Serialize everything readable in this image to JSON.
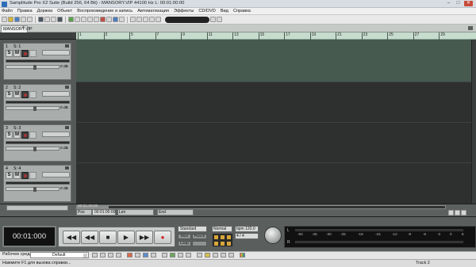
{
  "window": {
    "title": "Samplitude Pro X2 Suite (Build 256, 64 Bit)   -   MANSORY.VIP   44100 Hz L: 00:01:00:00",
    "minimize": "–",
    "maximize": "□",
    "close": "✕"
  },
  "menu": [
    "Файл",
    "Правка",
    "Доржка",
    "Объект",
    "Воспроизведение и запись",
    "Автоматизация",
    "Эффекты",
    "CD/DVD",
    "Вид",
    "Справка"
  ],
  "tab": {
    "label": "MANSORY.VIP",
    "close": "x"
  },
  "ruler": {
    "ticks": [
      "1",
      "3",
      "5",
      "7",
      "9",
      "11",
      "13",
      "15",
      "17",
      "19",
      "21",
      "23",
      "25",
      "27",
      "29"
    ]
  },
  "tracks": [
    {
      "number": "1",
      "name": "S: 1",
      "solo": "S",
      "mute": "M",
      "volume_db": "0 dB"
    },
    {
      "number": "2",
      "name": "S: 2",
      "solo": "S",
      "mute": "M",
      "volume_db": "0 dB"
    },
    {
      "number": "3",
      "name": "S: 3",
      "solo": "S",
      "mute": "M",
      "volume_db": "0 dB"
    },
    {
      "number": "4",
      "name": "S: 4",
      "solo": "S",
      "mute": "M",
      "volume_db": "0 dB"
    }
  ],
  "position": {
    "time_small": "00:01:00:00",
    "pos_label": "Pos",
    "pos_value": "00:01:00:00",
    "len_label": "Len",
    "len_value": "",
    "end_label": "End",
    "end_value": ""
  },
  "transport": {
    "time": "00:01:000",
    "mode": "Standard",
    "mode_buttons": [
      "Mon",
      "Punch",
      "Loop"
    ],
    "sync_mode": "Normal",
    "bpm": "bpm 120.0",
    "signature": "4 / 4",
    "symbols": {
      "rewind": "◀◀",
      "ffwd": "▶▶",
      "stop": "■",
      "play": "▶",
      "fwd": "▶▶",
      "rec": "●"
    }
  },
  "meter": {
    "left": "L",
    "right": "R",
    "scale": [
      "-60",
      "-45",
      "-30",
      "-25",
      "-18",
      "-15",
      "-12",
      "-9",
      "-6",
      "-3",
      "0",
      "6"
    ]
  },
  "workspace": {
    "label": "Рабочее среда:",
    "value": "Default"
  },
  "status": {
    "help": "Нажмите F1 для вызова справки...",
    "track": "Track 2"
  },
  "colors": {
    "lane_selected": "#465a50",
    "ruler": "#c6dccd",
    "record": "#cc2222"
  }
}
